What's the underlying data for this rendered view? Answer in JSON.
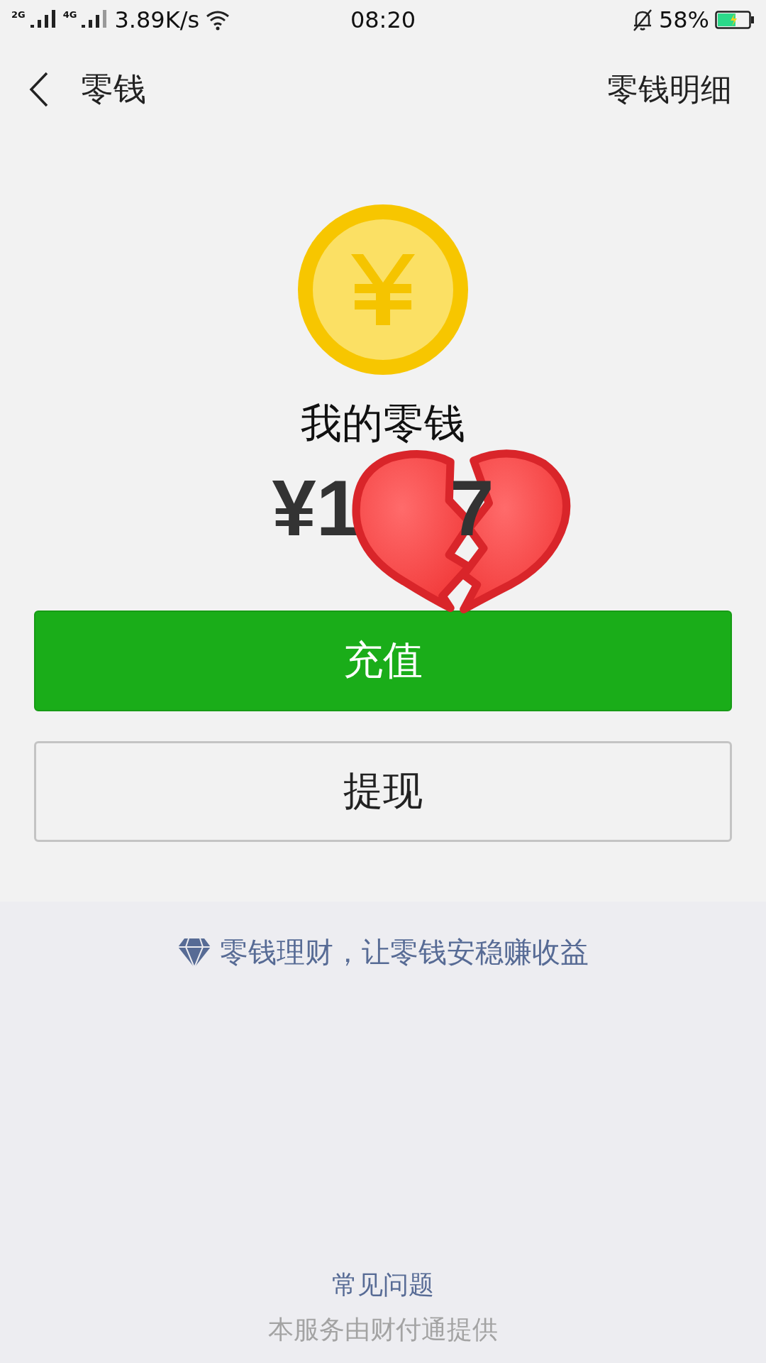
{
  "status_bar": {
    "sim_1": "2G",
    "sim_2": "4G",
    "speed": "3.89K/s",
    "time": "08:20",
    "battery": "58%",
    "charging": true
  },
  "nav": {
    "title": "零钱",
    "action": "零钱明细"
  },
  "balance": {
    "label": "我的零钱",
    "amount_parts": [
      "¥1",
      "7"
    ]
  },
  "buttons": [
    {
      "kind": "primary",
      "label": "充值"
    },
    {
      "kind": "outline",
      "label": "提现"
    }
  ],
  "promo": "零钱理财，让零钱安稳赚收益",
  "footer": {
    "faq": "常见问题",
    "provider": "本服务由财付通提供"
  }
}
